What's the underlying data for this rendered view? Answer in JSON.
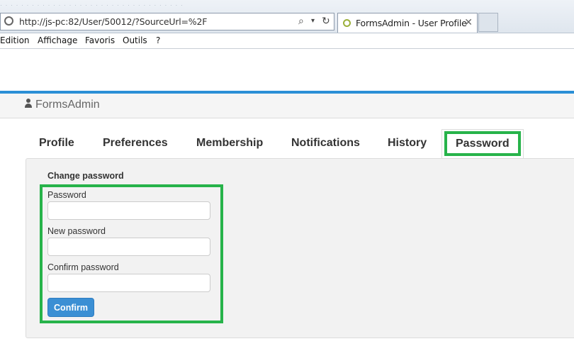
{
  "browser": {
    "url": "http://js-pc:82/User/50012/?SourceUrl=%2F",
    "tab_title": "FormsAdmin - User Profile",
    "menu": [
      "Edition",
      "Affichage",
      "Favoris",
      "Outils",
      "?"
    ]
  },
  "app": {
    "brand": "FormsAdmin",
    "tabs": [
      "Profile",
      "Preferences",
      "Membership",
      "Notifications",
      "History",
      "Password"
    ],
    "active_tab": "Password",
    "accent_color": "#2b8fd6",
    "highlight_color": "#27b34a"
  },
  "form": {
    "title": "Change password",
    "fields": [
      {
        "label": "Password",
        "value": ""
      },
      {
        "label": "New password",
        "value": ""
      },
      {
        "label": "Confirm password",
        "value": ""
      }
    ],
    "confirm_label": "Confirm"
  }
}
